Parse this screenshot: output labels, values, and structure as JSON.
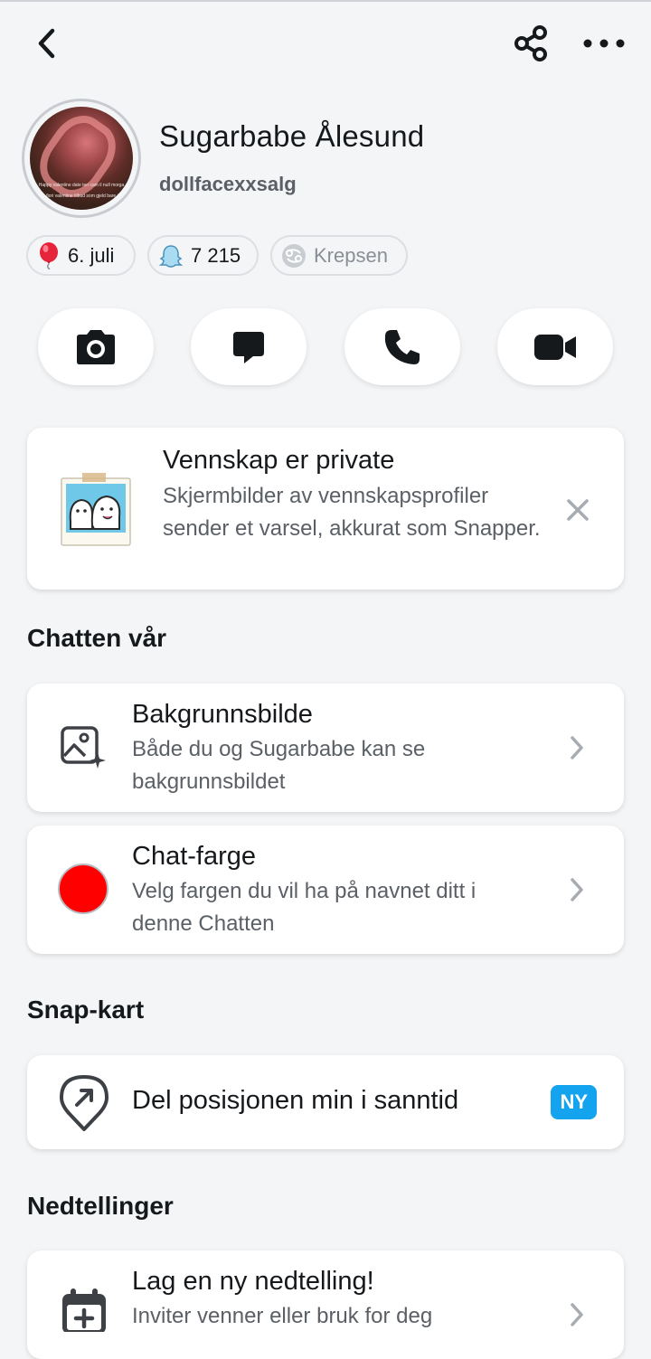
{
  "header": {
    "back_icon": "chevron-left-icon",
    "share_icon": "share-icon",
    "more_icon": "ellipsis-icon"
  },
  "profile": {
    "display_name": "Sugarbabe Ålesund",
    "username": "dollfacexxsalg",
    "avatar_caption_1": "Happy valentine date ten cam il null morga",
    "avatar_caption_2": "Bro en fiori valentine tilbud som gjeld bare imorga"
  },
  "chips": {
    "birthday": {
      "icon": "balloon-icon",
      "label": "6. juli"
    },
    "score": {
      "icon": "ghost-icon",
      "label": "7 215"
    },
    "zodiac": {
      "icon": "cancer-zodiac-icon",
      "label": "Krepsen"
    }
  },
  "actions": [
    {
      "name": "camera",
      "icon": "camera-icon"
    },
    {
      "name": "chat",
      "icon": "chat-bubble-icon"
    },
    {
      "name": "call",
      "icon": "phone-icon"
    },
    {
      "name": "video",
      "icon": "video-icon"
    }
  ],
  "private_notice": {
    "title": "Vennskap er private",
    "description": "Skjermbilder av vennskapsprofiler sender et varsel, akkurat som Snapper."
  },
  "sections": {
    "chat": {
      "title": "Chatten vår",
      "wallpaper": {
        "label": "Bakgrunnsbilde",
        "description": "Både du og Sugarbabe kan se bakgrunnsbildet"
      },
      "chat_color": {
        "label": "Chat-farge",
        "description": "Velg fargen du vil ha på navnet ditt i denne Chatten",
        "color": "#ff0000"
      }
    },
    "map": {
      "title": "Snap-kart",
      "share_location": {
        "label": "Del posisjonen min i sanntid",
        "badge": "NY"
      }
    },
    "countdowns": {
      "title": "Nedtellinger",
      "new_countdown": {
        "label": "Lag en ny nedtelling!",
        "description": "Inviter venner eller bruk for deg"
      }
    }
  },
  "colors": {
    "background": "#f4f5f7",
    "badge_blue": "#14a3ef",
    "text_primary": "#16191c",
    "text_secondary": "#5b6066"
  }
}
